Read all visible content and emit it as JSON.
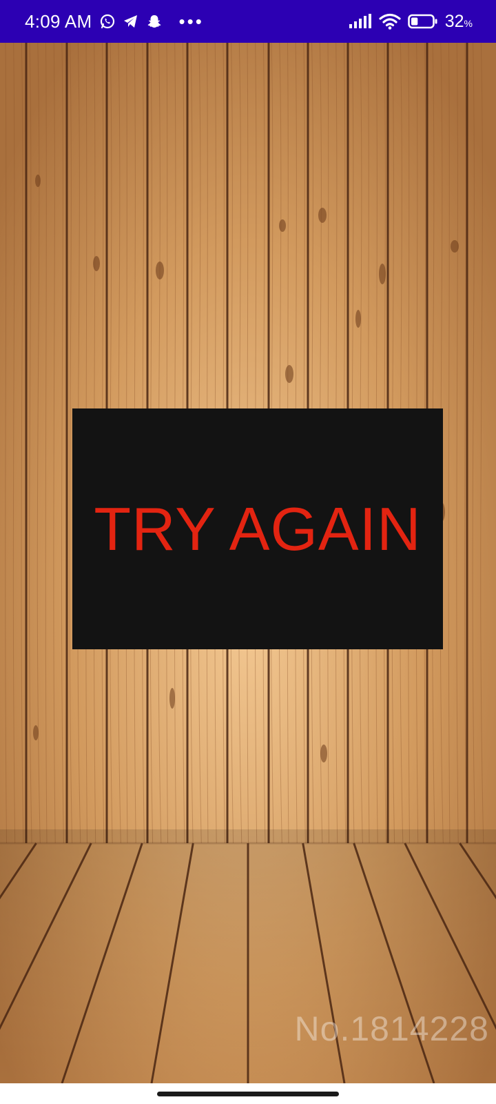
{
  "status_bar": {
    "time": "4:09 AM",
    "notification_icons": [
      "whatsapp-icon",
      "telegram-icon",
      "snapchat-icon"
    ],
    "overflow": "•••",
    "battery_level": "32",
    "battery_unit": "%",
    "battery_fraction": 0.32,
    "background_color": "#2c00b3"
  },
  "main": {
    "button_label": "TRY AGAIN",
    "button_text_color": "#e32411",
    "button_background": "#131313",
    "watermark": "No.1814228"
  }
}
